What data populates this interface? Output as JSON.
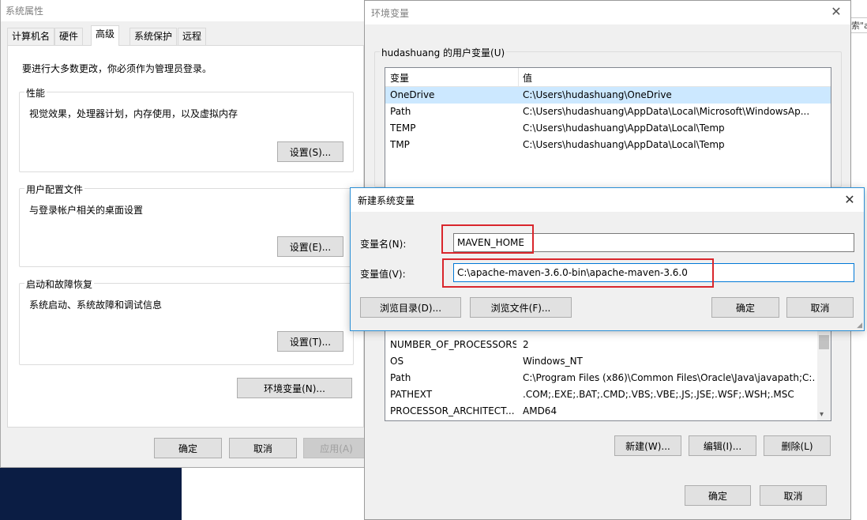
{
  "sys_props": {
    "title": "系统属性",
    "tabs": [
      "计算机名",
      "硬件",
      "高级",
      "系统保护",
      "远程"
    ],
    "admin_note": "要进行大多数更改，你必须作为管理员登录。",
    "performance": {
      "label": "性能",
      "desc": "视觉效果，处理器计划，内存使用，以及虚拟内存",
      "button": "设置(S)..."
    },
    "profile": {
      "label": "用户配置文件",
      "desc": "与登录帐户相关的桌面设置",
      "button": "设置(E)..."
    },
    "startup": {
      "label": "启动和故障恢复",
      "desc": "系统启动、系统故障和调试信息",
      "button": "设置(T)..."
    },
    "env_button": "环境变量(N)...",
    "ok": "确定",
    "cancel": "取消",
    "apply": "应用(A)"
  },
  "env_vars": {
    "title": "环境变量",
    "user_group_label": "hudashuang 的用户变量(U)",
    "col_var": "变量",
    "col_val": "值",
    "user_rows": [
      {
        "name": "OneDrive",
        "value": "C:\\Users\\hudashuang\\OneDrive"
      },
      {
        "name": "Path",
        "value": "C:\\Users\\hudashuang\\AppData\\Local\\Microsoft\\WindowsAp..."
      },
      {
        "name": "TEMP",
        "value": "C:\\Users\\hudashuang\\AppData\\Local\\Temp"
      },
      {
        "name": "TMP",
        "value": "C:\\Users\\hudashuang\\AppData\\Local\\Temp"
      }
    ],
    "sys_rows": [
      {
        "name": "NUMBER_OF_PROCESSORS",
        "value": "2"
      },
      {
        "name": "OS",
        "value": "Windows_NT"
      },
      {
        "name": "Path",
        "value": "C:\\Program Files (x86)\\Common Files\\Oracle\\Java\\javapath;C:..."
      },
      {
        "name": "PATHEXT",
        "value": ".COM;.EXE;.BAT;.CMD;.VBS;.VBE;.JS;.JSE;.WSF;.WSH;.MSC"
      },
      {
        "name": "PROCESSOR_ARCHITECT...",
        "value": "AMD64"
      }
    ],
    "new_button": "新建(W)...",
    "edit_button": "编辑(I)...",
    "delete_button": "删除(L)",
    "ok": "确定",
    "cancel": "取消"
  },
  "new_var": {
    "title": "新建系统变量",
    "name_label": "变量名(N):",
    "name_value": "MAVEN_HOME",
    "value_label": "变量值(V):",
    "value_value": "C:\\apache-maven-3.6.0-bin\\apache-maven-3.6.0",
    "browse_dir": "浏览目录(D)...",
    "browse_file": "浏览文件(F)...",
    "ok": "确定",
    "cancel": "取消"
  },
  "bg_snippet": "索\"ap",
  "colors": {
    "accent": "#0078d7",
    "highlight": "#d9262c",
    "desktop": "#0a1a3a"
  }
}
